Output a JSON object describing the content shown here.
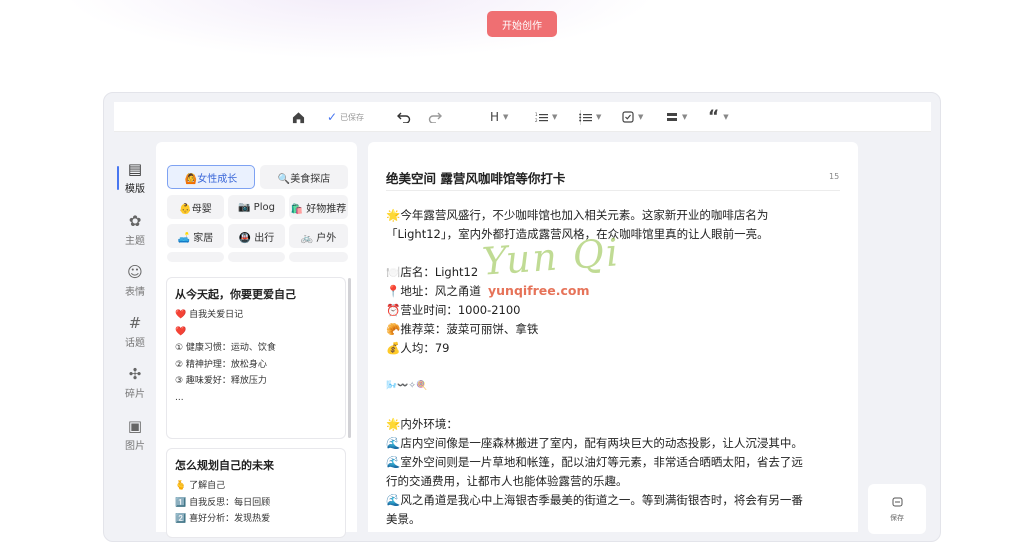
{
  "header": {
    "cta_label": "开始创作"
  },
  "toolbar": {
    "home_icon": "home-icon",
    "saved_label": "已保存",
    "heading_label": "H",
    "items": [
      "undo-icon",
      "redo-icon",
      "heading-icon",
      "ordered-list-icon",
      "bullet-list-icon",
      "checkbox-icon",
      "divider-icon",
      "quote-icon"
    ]
  },
  "rail": {
    "items": [
      {
        "label": "模版",
        "icon": "template-icon",
        "glyph": "▤",
        "active": true
      },
      {
        "label": "主题",
        "icon": "palette-icon",
        "glyph": "✿"
      },
      {
        "label": "表情",
        "icon": "emoji-icon",
        "glyph": "☺"
      },
      {
        "label": "话题",
        "icon": "hash-icon",
        "glyph": "#"
      },
      {
        "label": "碎片",
        "icon": "puzzle-icon",
        "glyph": "✣"
      },
      {
        "label": "图片",
        "icon": "image-icon",
        "glyph": "▣"
      }
    ]
  },
  "categories": [
    {
      "label": "🙆女性成长",
      "selected": true
    },
    {
      "label": "🔍美食探店"
    },
    {
      "label": "👶母婴"
    },
    {
      "label": "📷 Plog"
    },
    {
      "label": "🛍️ 好物推荐"
    },
    {
      "label": "🛋️ 家居"
    },
    {
      "label": "🚇 出行"
    },
    {
      "label": "🚲 户外"
    }
  ],
  "template_cards": [
    {
      "title": "从今天起，你要更爱自己",
      "lines": [
        "❤️ 自我关爱日记",
        "",
        "❤️",
        "① 健康习惯：运动、饮食",
        "② 精神护理：放松身心",
        "③ 趣味爱好：释放压力",
        "    ..."
      ]
    },
    {
      "title": "怎么规划自己的未来",
      "lines": [
        "🫰 了解自己",
        "1️⃣ 自我反思：每日回顾",
        "2️⃣ 喜好分析：发现热爱"
      ]
    }
  ],
  "editor": {
    "title": "绝美空间 露营风咖啡馆等你打卡",
    "char_count": "15",
    "paragraphs": [
      "🌟今年露营风盛行，不少咖啡馆也加入相关元素。这家新开业的咖啡店名为",
      "「Light12」，室内外都打造成露营风格，在众咖啡馆里真的让人眼前一亮。",
      "",
      "🍽️店名：Light12",
      "📍地址：风之甬道",
      "⏰营业时间：1000-2100",
      "🥐推荐菜：菠菜可丽饼、拿铁",
      "💰人均：79",
      "",
      "🌬️〰️✧🍭",
      "",
      "🌟内外环境：",
      "🌊店内空间像是一座森林搬进了室内，配有两块巨大的动态投影，让人沉浸其中。",
      "🌊室外空间则是一片草地和帐篷，配以油灯等元素，非常适合晒晒太阳，省去了远",
      "行的交通费用，让都市人也能体验露营的乐趣。",
      "🌊风之甬道是我心中上海银杏季最美的街道之一。等到满街银杏时，将会有另一番",
      "美景。"
    ]
  },
  "watermark": {
    "logo_text": "Yun Qi",
    "url_text": "yunqifree.com"
  },
  "save_panel": {
    "label": "保存",
    "icon": "save-icon"
  },
  "colors": {
    "accent": "#4876f0",
    "cta": "#ef6f72",
    "frame": "#f1f2f6"
  }
}
